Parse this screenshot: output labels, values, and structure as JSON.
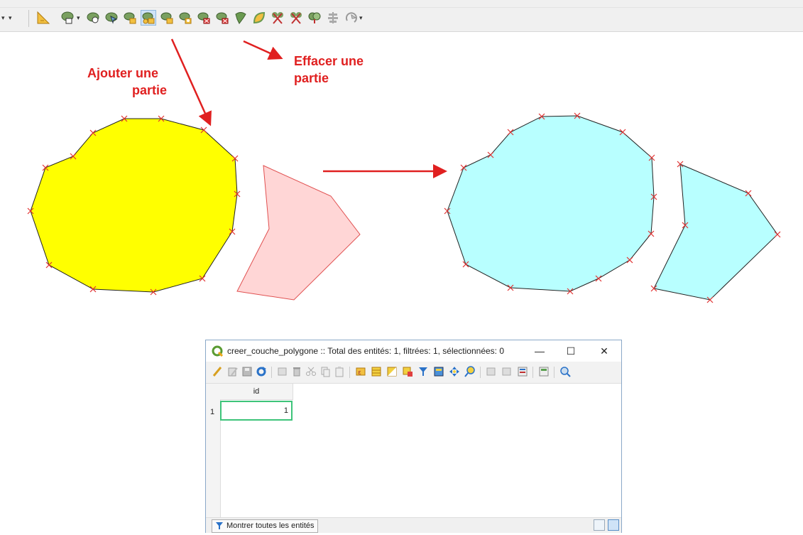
{
  "toolbar": {
    "icons": [
      "dropdown-arrow-icon",
      "measure-tool-icon",
      "add-ring-icon",
      "dropdown-arrow-icon",
      "fill-ring-icon",
      "reshape-features-icon",
      "add-part-icon",
      "add-part-active-icon",
      "rotate-part-icon",
      "delete-ring-icon",
      "delete-part-icon",
      "offset-curve-icon",
      "simplify-icon",
      "split-features-icon",
      "split-parts-icon",
      "merge-features-icon",
      "align-icon",
      "rotate-point-icon",
      "dropdown-arrow-icon"
    ],
    "active_tool": "add-part-active-icon"
  },
  "annotations": {
    "add_part": {
      "line1": "Ajouter une",
      "line2": "partie"
    },
    "delete_part": {
      "line1": "Effacer une",
      "line2": "partie"
    },
    "color": "#e02020"
  },
  "map": {
    "before_fill": "#ffff00",
    "removed_part_fill": "#ffd6d6",
    "after_fill": "#b8ffff",
    "vertex_color": "#e03030"
  },
  "attribute_table": {
    "title": "creer_couche_polygone :: Total des entités: 1, filtrées: 1, sélectionnées: 0",
    "minimize": "—",
    "maximize": "☐",
    "close": "✕",
    "columns": [
      "id"
    ],
    "rows": [
      {
        "row_number": "1",
        "id": "1"
      }
    ],
    "show_all_button": "Montrer toutes les entités"
  }
}
